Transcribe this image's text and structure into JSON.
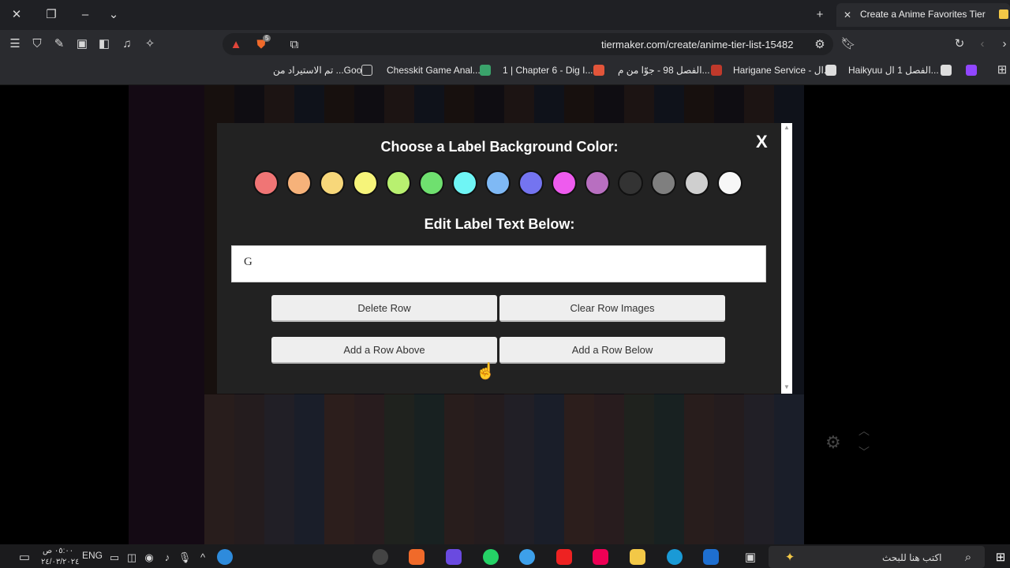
{
  "browser": {
    "tab_title": "Create a Anime Favorites Tier Lis",
    "url": "tiermaker.com/create/anime-tier-list-15482",
    "shield_badge": "5",
    "bookmarks": [
      {
        "label": "تم الاستيراد من ...Goo",
        "color": "#555"
      },
      {
        "label": "Chesskit Game Anal...",
        "color": "#3aa36b"
      },
      {
        "label": "1 | Chapter 6 - Dig I...",
        "color": "#e2553a"
      },
      {
        "label": "الفصل 98 - جوّا من م...",
        "color": "#c0392b"
      },
      {
        "label": "Harigane Service - ال...",
        "color": "#c8c8c8"
      },
      {
        "label": "Haikyuu الفصل 1 ال...",
        "color": "#c8c8c8"
      }
    ]
  },
  "modal": {
    "title": "Choose a Label Background Color:",
    "close_label": "X",
    "edit_label": "Edit Label Text Below:",
    "label_text": "G",
    "swatches": [
      "#f07575",
      "#f6b27a",
      "#f7d77a",
      "#f6f47a",
      "#b8f070",
      "#6fe06f",
      "#6ff5f5",
      "#7fb9f5",
      "#7474f0",
      "#ee5bee",
      "#b86fc0",
      "#333333",
      "#7f7f7f",
      "#cfcfcf",
      "#f7f7f7"
    ],
    "buttons": {
      "delete_row": "Delete Row",
      "clear_images": "Clear Row Images",
      "add_above": "Add a Row Above",
      "add_below": "Add a Row Below"
    }
  },
  "taskbar": {
    "time": "٠٥:٠٠ ص",
    "date": "٢٤/٠٣/٢٠٢٤",
    "lang": "ENG",
    "search_placeholder": "اكتب هنا للبحث"
  }
}
